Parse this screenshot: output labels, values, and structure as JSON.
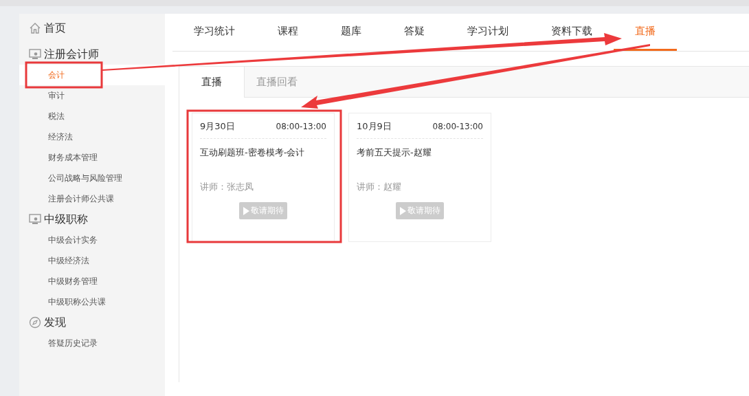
{
  "sidebar": {
    "sections": [
      {
        "title": "首页"
      },
      {
        "title": "注册会计师",
        "items": [
          {
            "label": "会计",
            "selected": true
          },
          {
            "label": "审计",
            "selected": false
          },
          {
            "label": "税法",
            "selected": false
          },
          {
            "label": "经济法",
            "selected": false
          },
          {
            "label": "财务成本管理",
            "selected": false
          },
          {
            "label": "公司战略与风险管理",
            "selected": false
          },
          {
            "label": "注册会计师公共课",
            "selected": false
          }
        ]
      },
      {
        "title": "中级职称",
        "items": [
          {
            "label": "中级会计实务",
            "selected": false
          },
          {
            "label": "中级经济法",
            "selected": false
          },
          {
            "label": "中级财务管理",
            "selected": false
          },
          {
            "label": "中级职称公共课",
            "selected": false
          }
        ]
      },
      {
        "title": "发现",
        "items": [
          {
            "label": "答疑历史记录",
            "selected": false
          }
        ]
      }
    ]
  },
  "tabs": [
    {
      "label": "学习统计",
      "selected": false
    },
    {
      "label": "课程",
      "selected": false
    },
    {
      "label": "题库",
      "selected": false
    },
    {
      "label": "答疑",
      "selected": false
    },
    {
      "label": "学习计划",
      "selected": false
    },
    {
      "label": "资料下载",
      "selected": false
    },
    {
      "label": "直播",
      "selected": true
    }
  ],
  "subtabs": [
    {
      "label": "直播",
      "selected": true
    },
    {
      "label": "直播回看",
      "selected": false
    }
  ],
  "lives": [
    {
      "date": "9月30日",
      "time": "08:00-13:00",
      "title": "互动刷题班-密卷模考-会计",
      "teacher": "讲师：张志凤",
      "button": "敬请期待",
      "disabled": true
    },
    {
      "date": "10月9日",
      "time": "08:00-13:00",
      "title": "考前五天提示-赵耀",
      "teacher": "讲师：赵耀",
      "button": "敬请期待",
      "disabled": true
    }
  ]
}
